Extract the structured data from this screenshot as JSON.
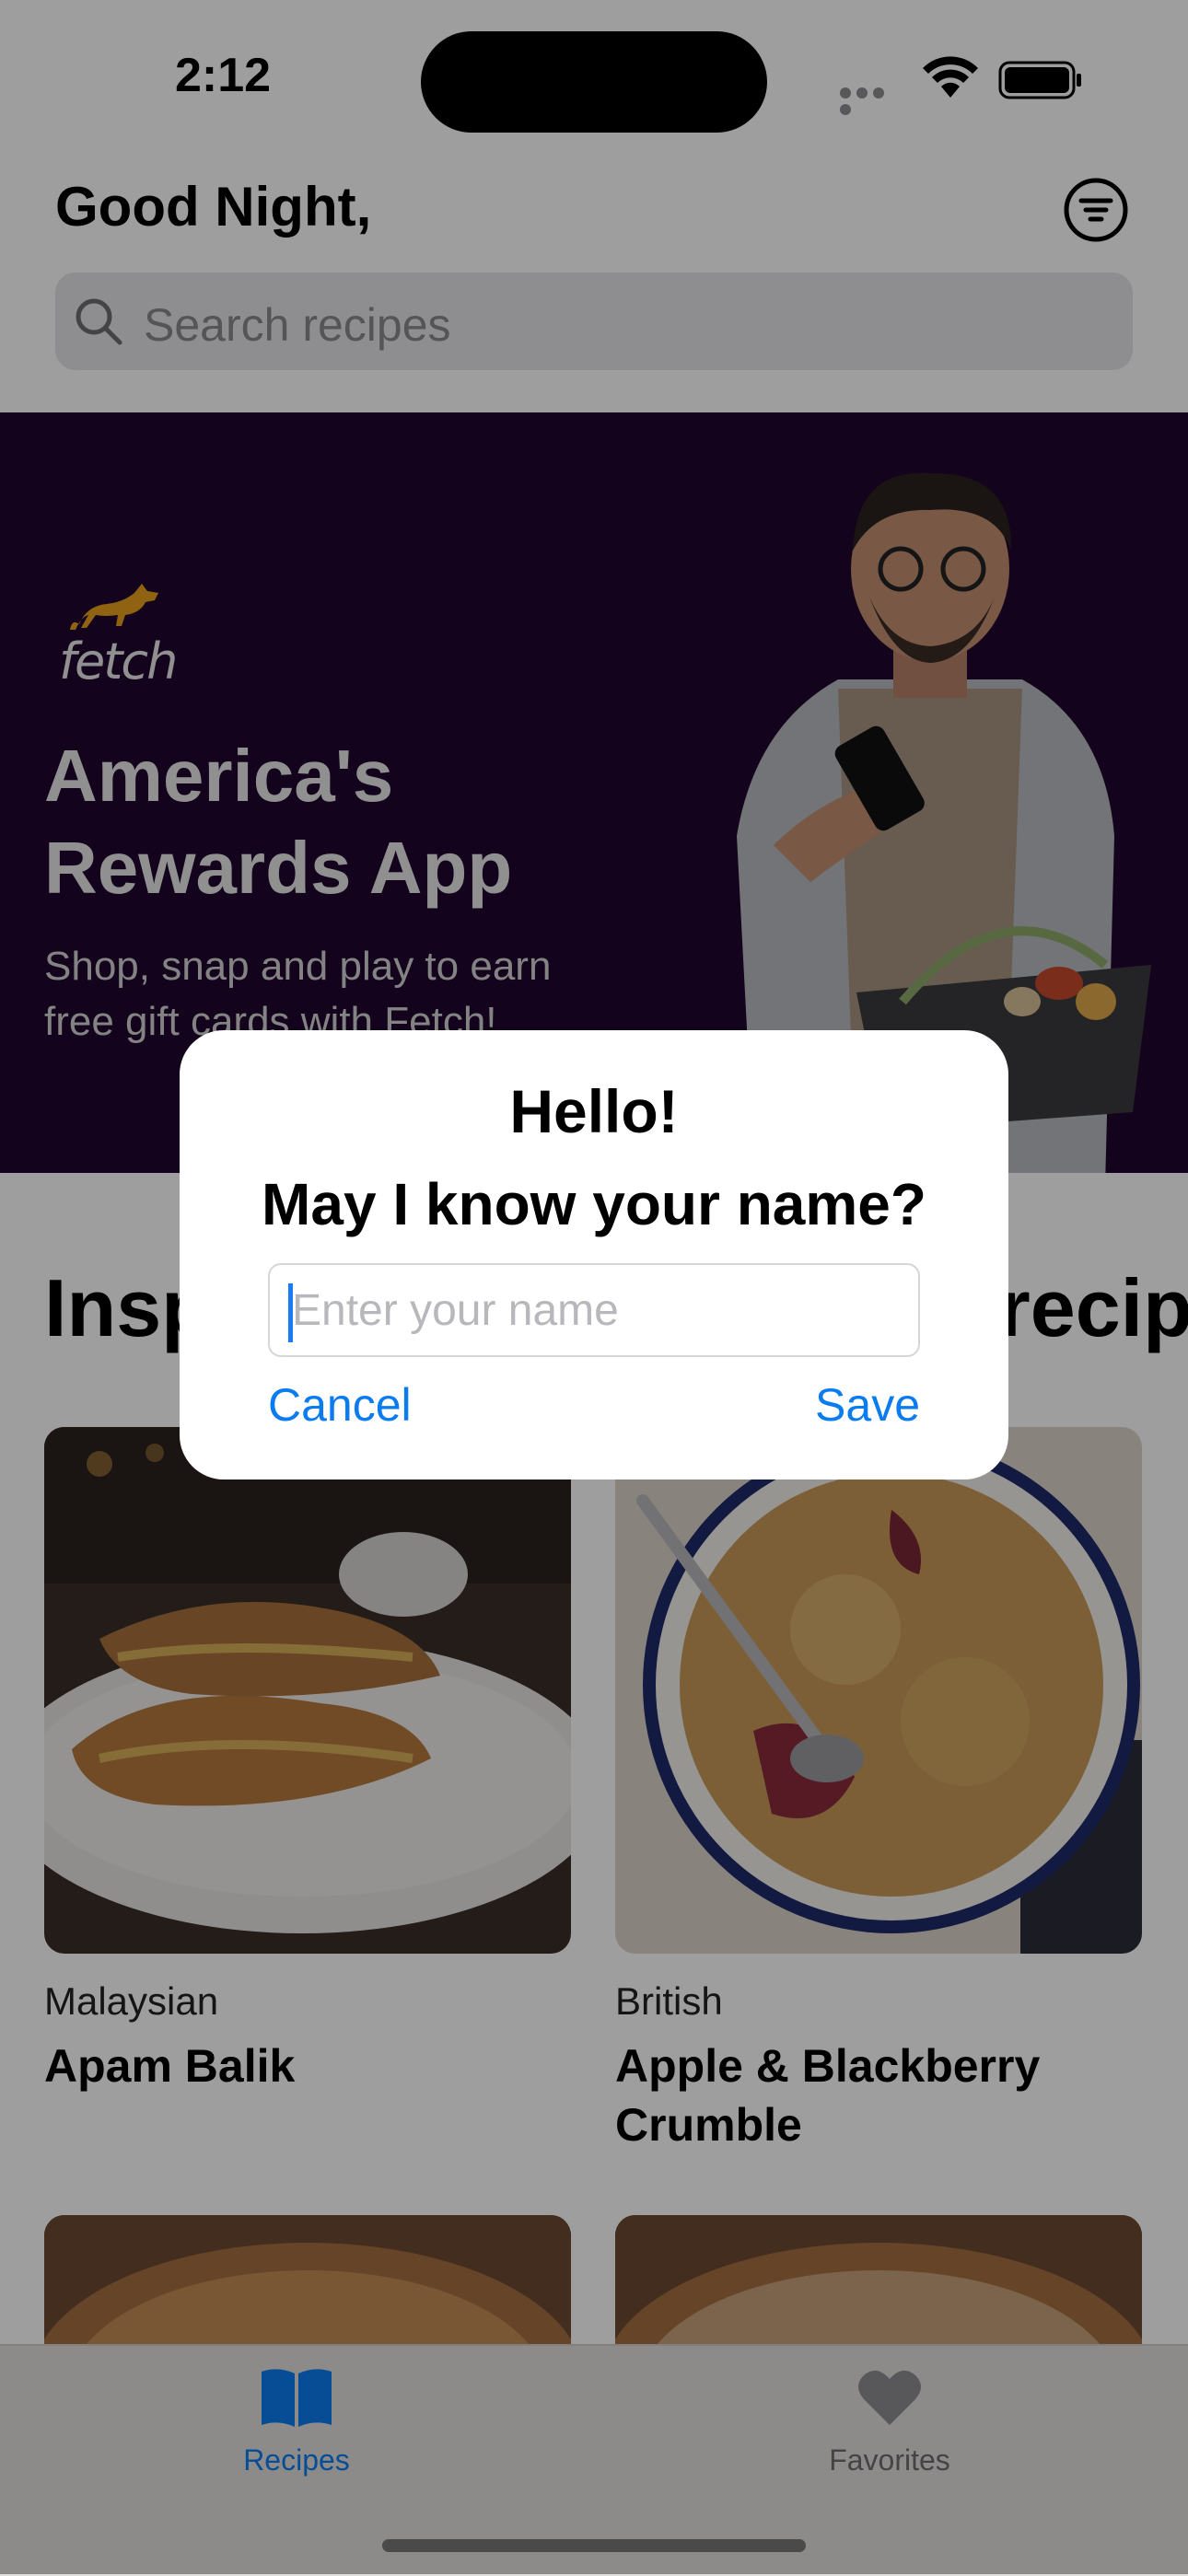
{
  "status_bar": {
    "time": "2:12"
  },
  "header": {
    "greeting": "Good Night,",
    "search_placeholder": "Search recipes"
  },
  "banner": {
    "logo_text": "fetch",
    "title_line1": "America's",
    "title_line2": "Rewards App",
    "subtitle_line1": "Shop, snap and play to earn",
    "subtitle_line2": "free gift cards with Fetch!"
  },
  "section": {
    "title": "Inspiration for your next recipe"
  },
  "recipes": [
    {
      "category": "Malaysian",
      "name": "Apam Balik"
    },
    {
      "category": "British",
      "name": "Apple & Blackberry Crumble"
    }
  ],
  "dialog": {
    "title": "Hello!",
    "message": "May I know your name?",
    "input_placeholder": "Enter your name",
    "cancel_label": "Cancel",
    "save_label": "Save"
  },
  "tabbar": {
    "items": [
      {
        "label": "Recipes",
        "icon": "book-icon",
        "active": true
      },
      {
        "label": "Favorites",
        "icon": "heart-icon",
        "active": false
      }
    ]
  },
  "colors": {
    "accent": "#0A7CF0",
    "banner_bg": "#21052E",
    "fetch_orange": "#E9A11F"
  }
}
